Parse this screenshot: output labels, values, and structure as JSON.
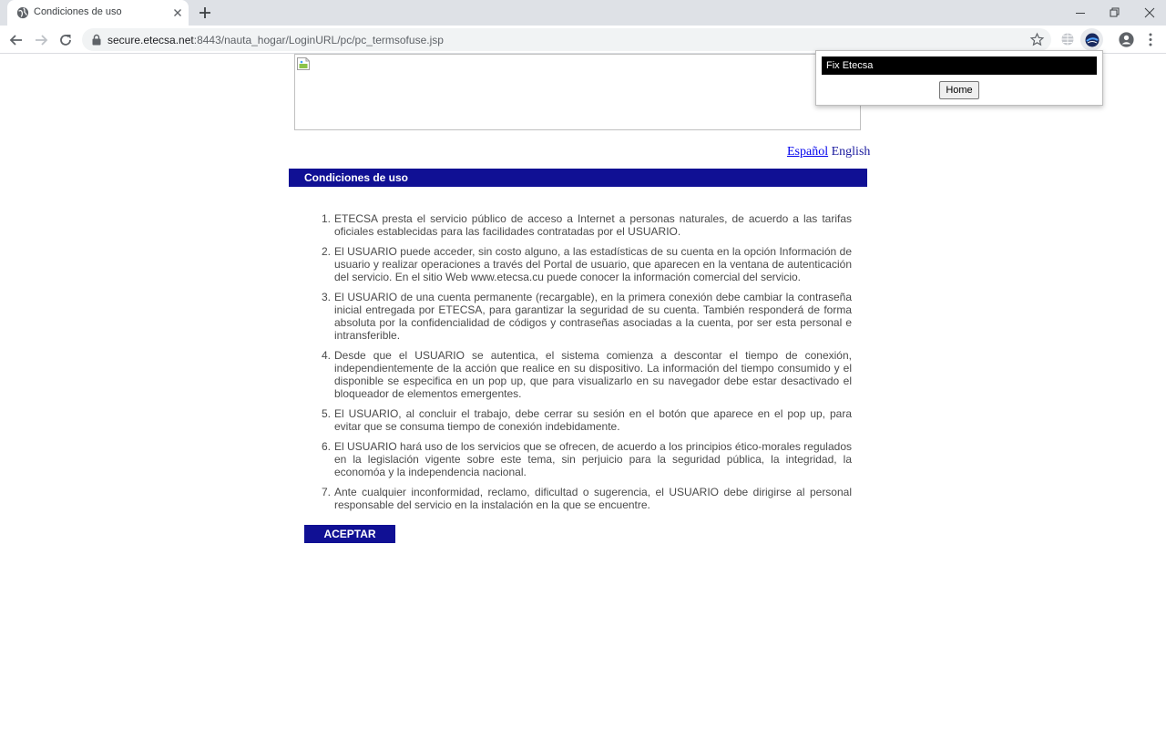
{
  "browser": {
    "tab_title": "Condiciones de uso",
    "url_host": "secure.etecsa.net",
    "url_rest": ":8443/nauta_hogar/LoginURL/pc/pc_termsofuse.jsp"
  },
  "popup": {
    "title": "Fix Etecsa",
    "home_label": "Home"
  },
  "languages": {
    "es": "Español",
    "en": "English"
  },
  "header": {
    "title": "Condiciones de uso"
  },
  "terms": [
    {
      "num": "1.",
      "text": "ETECSA presta el servicio público de acceso a Internet a personas naturales, de acuerdo a las tarifas oficiales establecidas para las facilidades contratadas por el USUARIO."
    },
    {
      "num": "2.",
      "text": "El USUARIO puede acceder, sin costo alguno, a las estadísticas de su cuenta en la opción Información de usuario y realizar operaciones a través del Portal de usuario, que aparecen en la ventana de autenticación del servicio. En el sitio Web www.etecsa.cu puede conocer la información comercial del servicio."
    },
    {
      "num": "3.",
      "text": "El USUARIO de una cuenta permanente (recargable), en la primera conexión debe cambiar la contraseña inicial entregada por ETECSA, para garantizar la seguridad de su cuenta. También responderá de forma absoluta por la confidencialidad de códigos y contraseñas asociadas a la cuenta, por ser esta personal e intransferible."
    },
    {
      "num": "4.",
      "text": "Desde que el USUARIO se autentica, el sistema comienza a descontar el tiempo de conexión, independientemente de la acción que realice en su dispositivo. La información del tiempo consumido y el disponible se especifica en un pop up, que para visualizarlo en su navegador debe estar desactivado el bloqueador de elementos emergentes."
    },
    {
      "num": "5.",
      "text": "El USUARIO, al concluir el trabajo, debe cerrar su sesión en el botón que aparece en el pop up, para evitar que se consuma tiempo de conexión indebidamente."
    },
    {
      "num": "6.",
      "text": "El USUARIO hará uso de los servicios que se ofrecen, de acuerdo a los principios ético-morales regulados en la legislación vigente sobre este tema, sin perjuicio para la seguridad pública, la integridad, la economóa y la independencia nacional."
    },
    {
      "num": "7.",
      "text": "Ante cualquier inconformidad, reclamo, dificultad o sugerencia, el USUARIO debe dirigirse al personal responsable del servicio en la instalación en la que se encuentre."
    }
  ],
  "accept_label": "ACEPTAR",
  "colors": {
    "header_bg": "#101094",
    "popup_title_bg": "#000000"
  }
}
